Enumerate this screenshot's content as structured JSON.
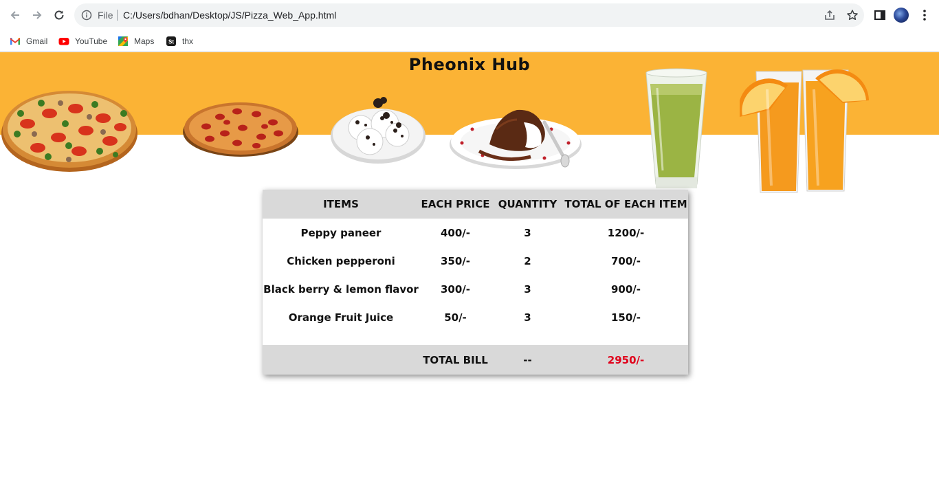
{
  "browser": {
    "omnibox": {
      "scheme_label": "File",
      "url": "C:/Users/bdhan/Desktop/JS/Pizza_Web_App.html"
    },
    "bookmarks": [
      {
        "label": "Gmail",
        "icon": "gmail-icon"
      },
      {
        "label": "YouTube",
        "icon": "youtube-icon"
      },
      {
        "label": "Maps",
        "icon": "maps-icon"
      },
      {
        "label": "thx",
        "icon": "st-icon"
      }
    ]
  },
  "page": {
    "brand": "Pheonix Hub",
    "banner_color": "#fbb335",
    "food_images": [
      "pizza-veggie",
      "pizza-pepperoni",
      "oreo-balls",
      "chocolate-lava-cake",
      "green-juice",
      "orange-juice"
    ]
  },
  "bill": {
    "headers": [
      "ITEMS",
      "EACH PRICE",
      "QUANTITY",
      "TOTAL OF EACH ITEM"
    ],
    "rows": [
      {
        "item": "Peppy paneer",
        "price": "400/-",
        "qty": "3",
        "total": "1200/-"
      },
      {
        "item": "Chicken pepperoni",
        "price": "350/-",
        "qty": "2",
        "total": "700/-"
      },
      {
        "item": "Black berry & lemon flavor",
        "price": "300/-",
        "qty": "3",
        "total": "900/-"
      },
      {
        "item": "Orange Fruit Juice",
        "price": "50/-",
        "qty": "3",
        "total": "150/-"
      }
    ],
    "footer": {
      "label": "TOTAL BILL",
      "qty": "--",
      "total": "2950/-"
    },
    "total_color": "#e0001b"
  }
}
